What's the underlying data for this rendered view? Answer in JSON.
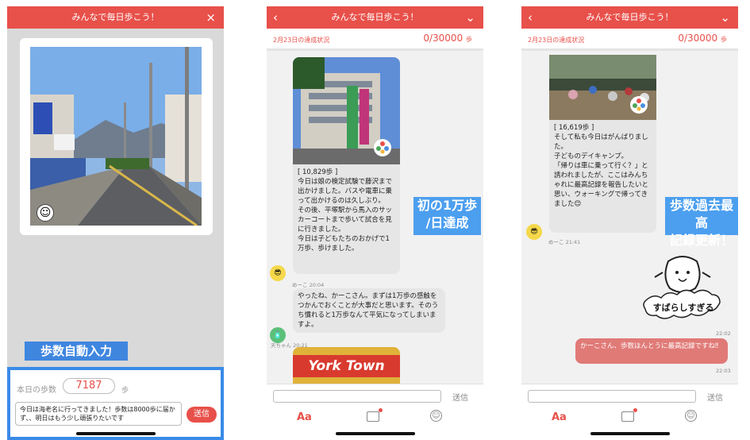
{
  "phone1": {
    "title": "みんなで毎日歩こう！",
    "close_icon": "×",
    "badge": "☺",
    "auto_label": "歩数自動入力",
    "steps_label": "本日の歩数",
    "steps_value": "7187",
    "steps_unit": "歩",
    "memo_text": "今日は海老名に行ってきました！歩数は8000歩に届かず、、明日はもう少し頑張りたいです",
    "send_label": "送信"
  },
  "phone2": {
    "title": "みんなで毎日歩こう！",
    "status_date": "2月23日の達成状況",
    "status_count": "0/30000",
    "status_unit": "歩",
    "post_text": "[ 10,829歩 ]\n今日は娘の検定試験で藤沢まで出かけました。バスや電車に乗って出かけるのは久しぶり。\nその後、平塚駅から馬入のサッカーコートまで歩いて試合を見に行きました。\n今日は子どもたちのおかげで1万歩、歩けました。",
    "post_author_time": "めーこ 20:04",
    "reply_text": "やったね、かーこさん。まずは1万歩の感触をつかんでおくことが大事だと思います。そのうち慣れると1万歩なんて平気になってしまいますよ。",
    "reply_author_time": "天ちゃん 20:21",
    "sign_text": "York Town",
    "highlight_line1": "初の1万歩",
    "highlight_line2": "/日達成",
    "send_label": "送信",
    "aa_label": "Aa"
  },
  "phone3": {
    "title": "みんなで毎日歩こう！",
    "status_date": "2月23日の達成状況",
    "status_count": "0/30000",
    "status_unit": "歩",
    "post_text": "[ 16,619歩 ]\nそして私も今日はがんばりました。\n子どものデイキャンプ。\n「帰りは車に乗って行く？」と誘われましたが、ここはみんちゃれに最高記録を報告したいと思い、ウォーキングで帰ってきました😊",
    "post_author_time": "めーこ 21:41",
    "sticker_text": "すばらしすぎる",
    "sticker_time": "22:02",
    "my_reply": "かーこさん、歩数ほんとうに最高記録ですね‼",
    "my_reply_time": "22:03",
    "highlight_line1": "歩数過去最高",
    "highlight_line2": "記録更新！",
    "send_label": "送信",
    "aa_label": "Aa"
  }
}
